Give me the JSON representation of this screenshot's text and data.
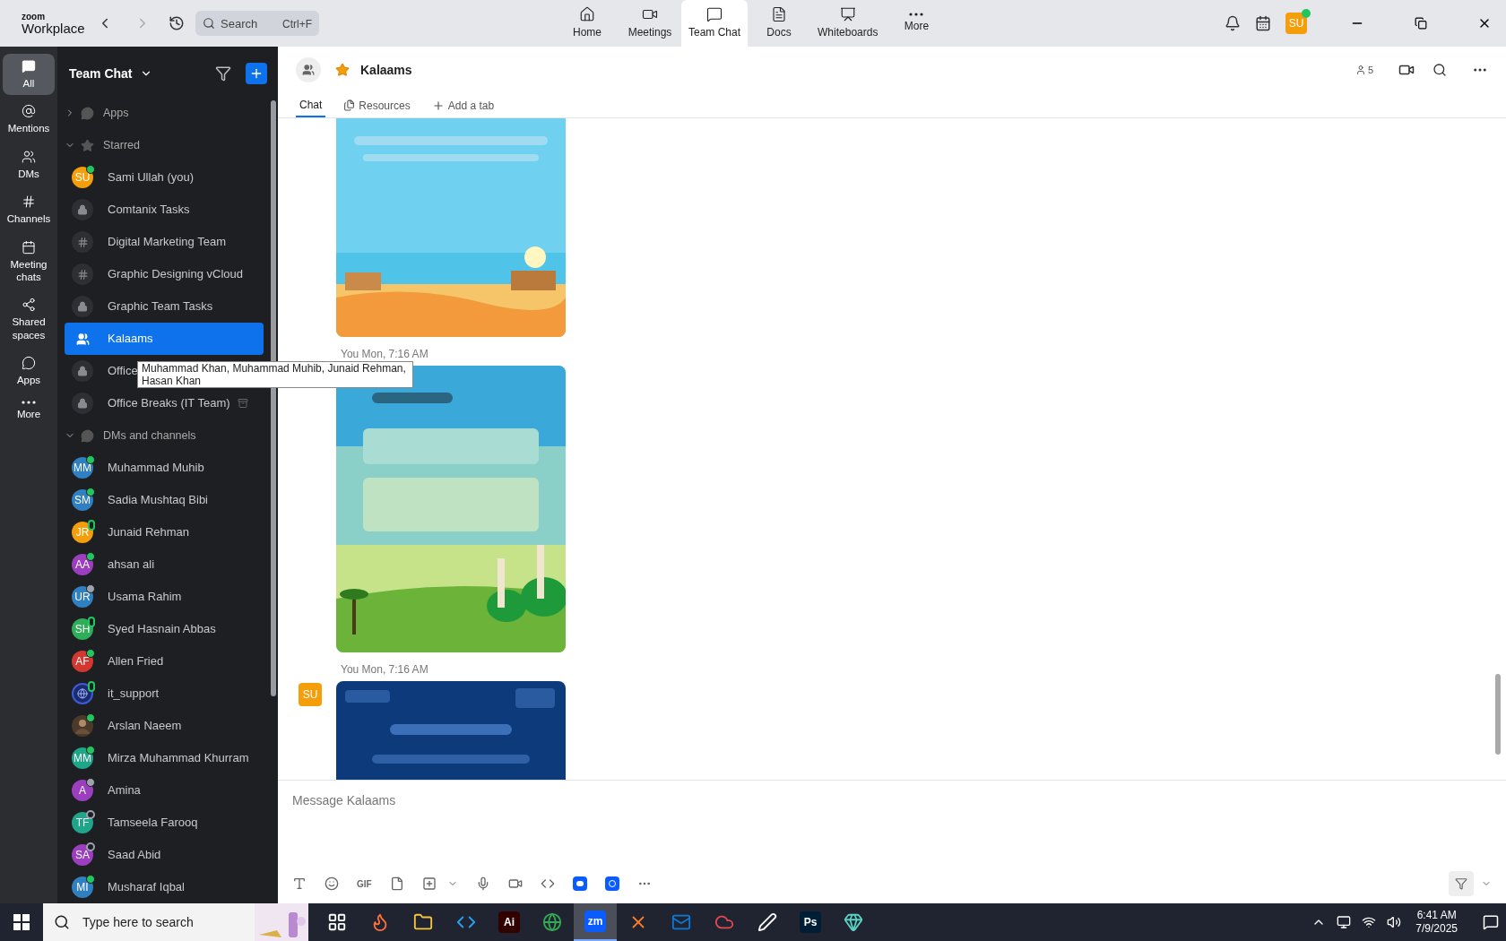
{
  "app": {
    "brand_top": "zoom",
    "brand_bottom": "Workplace",
    "search": {
      "placeholder": "Search",
      "shortcut": "Ctrl+F"
    },
    "nav": [
      {
        "label": "Home",
        "kind": "home",
        "selected": false
      },
      {
        "label": "Meetings",
        "kind": "meetings",
        "selected": false
      },
      {
        "label": "Team Chat",
        "kind": "chat",
        "selected": true
      },
      {
        "label": "Docs",
        "kind": "docs",
        "selected": false
      },
      {
        "label": "Whiteboards",
        "kind": "whiteboards",
        "selected": false
      },
      {
        "label": "More",
        "kind": "more",
        "selected": false
      }
    ],
    "user": {
      "initials": "SU",
      "online": true
    }
  },
  "rail": [
    {
      "label": "All",
      "kind": "all",
      "selected": true
    },
    {
      "label": "Mentions",
      "kind": "mentions",
      "selected": false
    },
    {
      "label": "DMs",
      "kind": "dms",
      "selected": false
    },
    {
      "label": "Channels",
      "kind": "channels",
      "selected": false
    },
    {
      "label": "Meeting chats",
      "kind": "meeting",
      "selected": false
    },
    {
      "label": "Shared spaces",
      "kind": "shared",
      "selected": false
    },
    {
      "label": "Apps",
      "kind": "apps",
      "selected": false
    },
    {
      "label": "More",
      "kind": "more",
      "selected": false
    }
  ],
  "sidebar": {
    "title": "Team Chat",
    "sections": [
      {
        "label": "Apps",
        "expanded": false
      },
      {
        "label": "Starred",
        "kind": "star",
        "expanded": true,
        "items": [
          {
            "name": "Sami Ullah (you)",
            "kind": "avatar",
            "initials": "SU",
            "color": "#f59e0b",
            "status": {
              "kind": "online"
            },
            "selected": false
          },
          {
            "name": "Comtanix Tasks",
            "kind": "lock",
            "selected": false
          },
          {
            "name": "Digital Marketing Team",
            "kind": "hash",
            "selected": false
          },
          {
            "name": "Graphic Designing vCloud",
            "kind": "hash",
            "selected": false
          },
          {
            "name": "Graphic Team Tasks",
            "kind": "lock",
            "selected": false
          },
          {
            "name": "Kalaams",
            "kind": "group",
            "selected": true
          },
          {
            "name": "Office",
            "kind": "lock",
            "selected": false
          },
          {
            "name": "Office Breaks (IT Team)",
            "kind": "lock",
            "archived": true,
            "selected": false
          }
        ]
      },
      {
        "label": "DMs and channels",
        "expanded": true,
        "items": [
          {
            "name": "Muhammad Muhib",
            "kind": "avatar",
            "initials": "MM",
            "color": "#2f7fc1",
            "status": {
              "kind": "online"
            },
            "selected": false
          },
          {
            "name": "Sadia Mushtaq Bibi",
            "kind": "avatar",
            "initials": "SM",
            "color": "#2f7fc1",
            "status": {
              "kind": "online"
            },
            "selected": false
          },
          {
            "name": "Junaid Rehman",
            "kind": "avatar",
            "initials": "JR",
            "color": "#f59e0b",
            "status": {
              "kind": "mobile"
            },
            "selected": false
          },
          {
            "name": "ahsan ali",
            "kind": "avatar",
            "initials": "AA",
            "color": "#9b3fbf",
            "status": {
              "kind": "online"
            },
            "selected": false
          },
          {
            "name": "Usama Rahim",
            "kind": "avatar",
            "initials": "UR",
            "color": "#2f7fc1",
            "status": {
              "kind": "away"
            },
            "selected": false
          },
          {
            "name": "Syed Hasnain Abbas",
            "kind": "avatar",
            "initials": "SH",
            "color": "#2fae5a",
            "status": {
              "kind": "mobile"
            },
            "selected": false
          },
          {
            "name": "Allen Fried",
            "kind": "avatar",
            "initials": "AF",
            "color": "#d2382f",
            "status": {
              "kind": "online"
            },
            "selected": false
          },
          {
            "name": "it_support",
            "kind": "logo",
            "status": {
              "kind": "mobile"
            },
            "selected": false
          },
          {
            "name": "Arslan Naeem",
            "status": {
              "kind": "online"
            },
            "selected": false
          },
          {
            "name": "Mirza Muhammad Khurram",
            "kind": "avatar",
            "initials": "MM",
            "color": "#1fa58a",
            "status": {
              "kind": "online"
            },
            "selected": false
          },
          {
            "name": "Amina",
            "kind": "avatar",
            "initials": "A",
            "color": "#9b3fbf",
            "status": {
              "kind": "away"
            },
            "selected": false
          },
          {
            "name": "Tamseela Farooq",
            "kind": "avatar",
            "initials": "TF",
            "color": "#1fa58a",
            "status": {
              "kind": "offline"
            },
            "selected": false
          },
          {
            "name": "Saad Abid",
            "kind": "avatar",
            "initials": "SA",
            "color": "#9b3fbf",
            "status": {
              "kind": "offline"
            },
            "selected": false
          },
          {
            "name": "Musharaf Iqbal",
            "kind": "avatar",
            "initials": "MI",
            "color": "#2f7fc1",
            "status": {
              "kind": "online"
            },
            "selected": false
          }
        ]
      }
    ]
  },
  "tooltip": "Muhammad Khan, Muhammad Muhib, Junaid Rehman, Hasan Khan",
  "chat": {
    "title": "Kalaams",
    "starred": true,
    "members": "5",
    "tabs": [
      {
        "label": "Chat",
        "kind": "chat",
        "selected": true
      },
      {
        "label": "Resources",
        "kind": "resources",
        "selected": false
      },
      {
        "label": "Add a tab",
        "kind": "add",
        "selected": false
      }
    ],
    "messages": [
      {
        "kind": "picture"
      },
      {
        "kind": "picture",
        "meta": "You Mon, 7:16 AM"
      },
      {
        "kind": "picture",
        "meta": "You Mon, 7:16 AM",
        "avatar": "SU"
      }
    ],
    "composer": {
      "placeholder": "Message Kalaams",
      "gif": "GIF"
    }
  },
  "taskbar": {
    "search_placeholder": "Type here to search",
    "apps": [
      {
        "kind": "taskview",
        "selected": false
      },
      {
        "kind": "firefox",
        "selected": false
      },
      {
        "kind": "folder",
        "selected": false
      },
      {
        "kind": "vscode",
        "selected": false
      },
      {
        "kind": "tile",
        "label": "Ai",
        "color": "#330000",
        "selected": false
      },
      {
        "kind": "chrome",
        "selected": false
      },
      {
        "kind": "tile",
        "label": "zm",
        "color": "#0b5cff",
        "selected": true
      },
      {
        "kind": "xampp",
        "selected": false
      },
      {
        "kind": "outlook",
        "selected": false
      },
      {
        "kind": "cloud",
        "selected": false
      },
      {
        "kind": "pen",
        "selected": false
      },
      {
        "kind": "tile",
        "label": "Ps",
        "color": "#001e36",
        "selected": false
      },
      {
        "kind": "gem",
        "selected": false
      }
    ],
    "time": "6:41 AM",
    "date": "7/9/2025"
  }
}
